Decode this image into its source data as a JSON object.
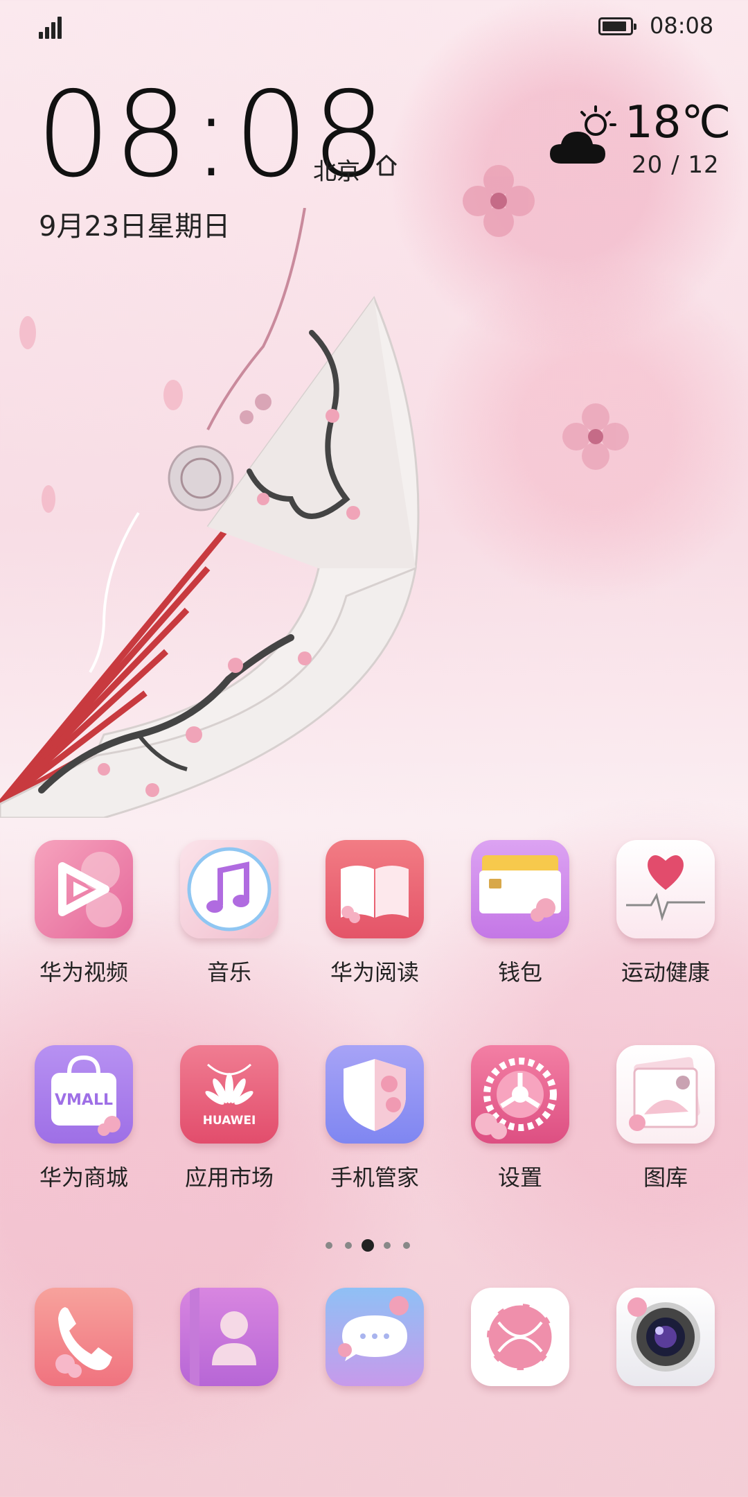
{
  "status_bar": {
    "time": "08:08",
    "signal_icon": "signal-icon",
    "battery_icon": "battery-icon",
    "battery_level": 0.9
  },
  "clock_widget": {
    "time": "08:08",
    "city": "北京",
    "date": "9月23日星期日",
    "home_icon": "home-icon"
  },
  "weather_widget": {
    "temperature": "18℃",
    "range": "20 / 12",
    "icon": "partly-cloudy-icon"
  },
  "apps_row1": [
    {
      "label": "华为视频",
      "icon": "video-play-icon"
    },
    {
      "label": "音乐",
      "icon": "music-note-icon"
    },
    {
      "label": "华为阅读",
      "icon": "book-icon"
    },
    {
      "label": "钱包",
      "icon": "wallet-card-icon"
    },
    {
      "label": "运动健康",
      "icon": "heart-pulse-icon"
    }
  ],
  "apps_row2": [
    {
      "label": "华为商城",
      "icon": "shopping-bag-icon",
      "text": "VMALL"
    },
    {
      "label": "应用市场",
      "icon": "huawei-logo-icon",
      "text": "HUAWEI"
    },
    {
      "label": "手机管家",
      "icon": "shield-icon"
    },
    {
      "label": "设置",
      "icon": "gear-icon"
    },
    {
      "label": "图库",
      "icon": "photo-gallery-icon"
    }
  ],
  "page_indicator": {
    "count": 5,
    "active_index": 2
  },
  "dock": [
    {
      "icon": "phone-icon"
    },
    {
      "icon": "contacts-icon"
    },
    {
      "icon": "messages-icon"
    },
    {
      "icon": "browser-icon"
    },
    {
      "icon": "camera-icon"
    }
  ],
  "colors": {
    "background": "#f8dde5",
    "text": "#222222",
    "accent_pink": "#ec6f93",
    "accent_purple": "#b777e8"
  }
}
